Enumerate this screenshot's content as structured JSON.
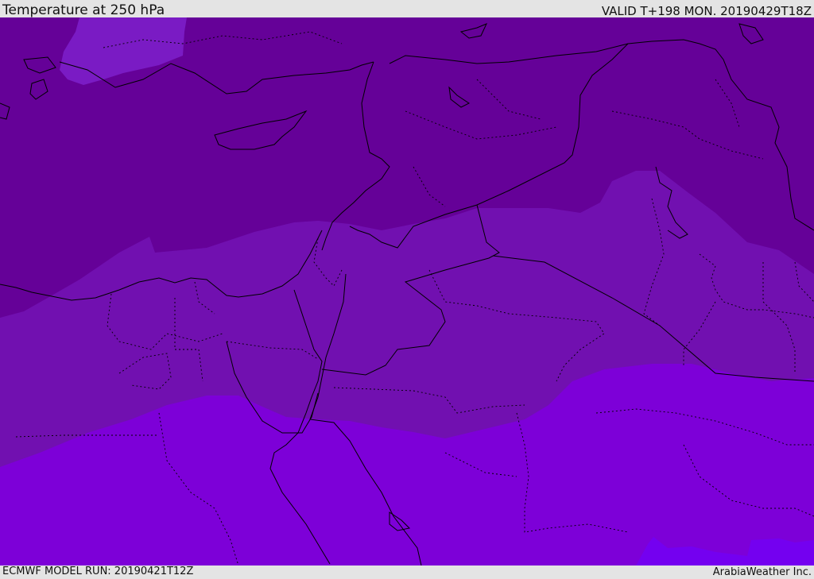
{
  "header": {
    "title": "Temperature at 250 hPa",
    "valid": "VALID T+198 MON. 20190429T18Z"
  },
  "footer": {
    "model_run": "ECMWF MODEL RUN: 20190421T12Z",
    "credit": "ArabiaWeather Inc."
  },
  "map": {
    "field": "temperature",
    "level": "250 hPa",
    "colors": {
      "band_coldest": "#650198",
      "band_cold": "#7110b0",
      "band_mild": "#7d00d8",
      "band_warm": "#7400f0",
      "band_pale": "#7a1bc4",
      "coastline": "#000000"
    }
  }
}
